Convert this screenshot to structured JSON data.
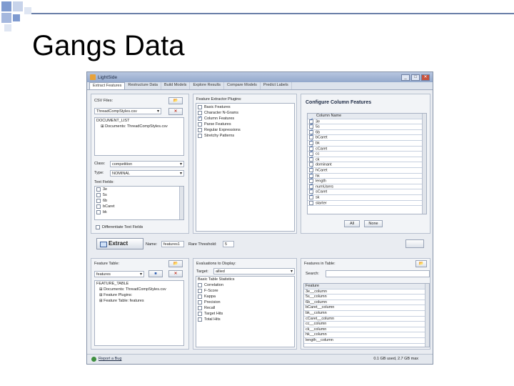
{
  "slide": {
    "title": "Gangs Data"
  },
  "window": {
    "title": "LightSide",
    "controls": [
      "_",
      "□",
      "✕"
    ],
    "tabs": [
      "Extract Features",
      "Restructure Data",
      "Build Models",
      "Explore Results",
      "Compare Models",
      "Predict Labels"
    ]
  },
  "csv": {
    "label": "CSV Files:",
    "file": "ThreadCompStyles.csv",
    "tree": [
      "DOCUMENT_LIST",
      "Documents: ThreadCompStyles.csv"
    ]
  },
  "class": {
    "label": "Class:",
    "value": "competition",
    "type_label": "Type:",
    "type_value": "NOMINAL"
  },
  "text_fields": {
    "label": "Text Fields:",
    "items": [
      "3e",
      "5s",
      "6b",
      "bCaret",
      "bk"
    ],
    "differentiate": "Differentiate Text Fields"
  },
  "plugins": {
    "label": "Feature Extractor Plugins:",
    "items": [
      {
        "name": "Basic Features",
        "checked": false
      },
      {
        "name": "Character N-Grams",
        "checked": false
      },
      {
        "name": "Column Features",
        "checked": true
      },
      {
        "name": "Parse Features",
        "checked": false
      },
      {
        "name": "Regular Expressions",
        "checked": false
      },
      {
        "name": "Stretchy Patterns",
        "checked": false
      }
    ]
  },
  "configure": {
    "title": "Configure Column Features",
    "header": "Column Name",
    "items": [
      {
        "name": "3e",
        "checked": true
      },
      {
        "name": "5s",
        "checked": true
      },
      {
        "name": "6b",
        "checked": true
      },
      {
        "name": "bCaret",
        "checked": true
      },
      {
        "name": "bk",
        "checked": true
      },
      {
        "name": "cCaret",
        "checked": true
      },
      {
        "name": "cc",
        "checked": true
      },
      {
        "name": "ck",
        "checked": true
      },
      {
        "name": "dominant",
        "checked": false
      },
      {
        "name": "hCaret",
        "checked": true
      },
      {
        "name": "hk",
        "checked": true
      },
      {
        "name": "length",
        "checked": true
      },
      {
        "name": "numUsers",
        "checked": true
      },
      {
        "name": "sCaret",
        "checked": true
      },
      {
        "name": "sk",
        "checked": true
      },
      {
        "name": "starter",
        "checked": false
      }
    ],
    "all_label": "All",
    "none_label": "None"
  },
  "extract": {
    "button": "Extract",
    "name_label": "Name:",
    "name_value": "features1",
    "rare_label": "Rare Threshold:",
    "rare_value": "5"
  },
  "feature_table": {
    "label": "Feature Table:",
    "value": "features",
    "tree": [
      "FEATURE_TABLE",
      "Documents: ThreadCompStyles.csv",
      "Feature Plugins:",
      "Feature Table: features"
    ]
  },
  "evaluations": {
    "label": "Evaluations to Display:",
    "target_label": "Target:",
    "target_value": "allied",
    "stats_label": "Basic Table Statistics",
    "items": [
      "Correlation",
      "F-Score",
      "Kappa",
      "Precision",
      "Recall",
      "Target Hits",
      "Total Hits"
    ]
  },
  "features_in_table": {
    "label": "Features in Table:",
    "search_label": "Search:",
    "header": "Feature",
    "rows": [
      "3e__column",
      "5s__column",
      "6b__column",
      "bCaret__column",
      "bk__column",
      "cCaret__column",
      "cc__column",
      "ck__column",
      "hk__column",
      "length__column"
    ]
  },
  "status": {
    "report": "Report a Bug",
    "memory": "0.1 GB used, 2.7 GB max"
  },
  "colors": {
    "accent": "#6a7fa8",
    "square_blue": "#7f9bd0"
  }
}
